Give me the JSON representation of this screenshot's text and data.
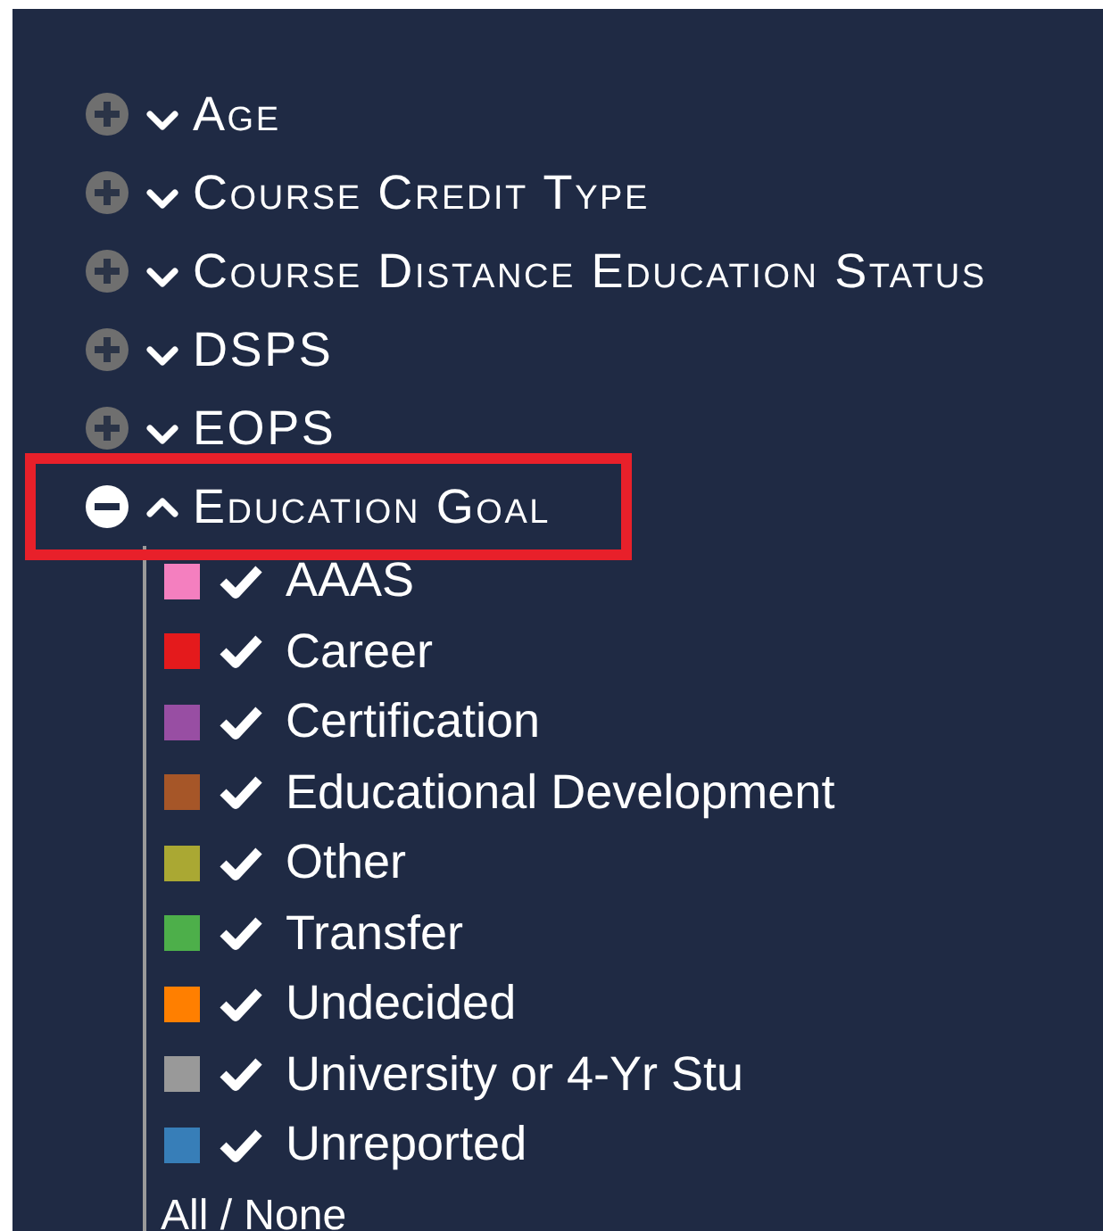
{
  "categories": [
    {
      "label": "Age",
      "expanded": false,
      "highlighted": false
    },
    {
      "label": "Course Credit Type",
      "expanded": false,
      "highlighted": false
    },
    {
      "label": "Course Distance Education Status",
      "expanded": false,
      "highlighted": false
    },
    {
      "label": "DSPS",
      "expanded": false,
      "highlighted": false
    },
    {
      "label": "EOPS",
      "expanded": false,
      "highlighted": false
    },
    {
      "label": "Education Goal",
      "expanded": true,
      "highlighted": true,
      "items": [
        {
          "label": "AAAS",
          "color": "#f47fbf",
          "checked": true
        },
        {
          "label": "Career",
          "color": "#e41a1c",
          "checked": true
        },
        {
          "label": "Certification",
          "color": "#984ea3",
          "checked": true
        },
        {
          "label": "Educational Development",
          "color": "#a65628",
          "checked": true
        },
        {
          "label": "Other",
          "color": "#aaa833",
          "checked": true
        },
        {
          "label": "Transfer",
          "color": "#4daf4a",
          "checked": true
        },
        {
          "label": "Undecided",
          "color": "#ff7f00",
          "checked": true
        },
        {
          "label": "University or 4-Yr Stu",
          "color": "#999999",
          "checked": true
        },
        {
          "label": "Unreported",
          "color": "#377eb8",
          "checked": true
        }
      ],
      "all_none": "All / None"
    }
  ]
}
